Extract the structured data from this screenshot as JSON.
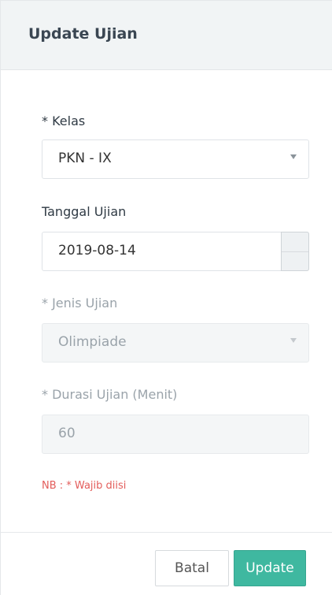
{
  "header": {
    "title": "Update Ujian"
  },
  "form": {
    "kelas": {
      "label": "* Kelas",
      "value": "PKN - IX"
    },
    "tanggal": {
      "label": "Tanggal Ujian",
      "value": "2019-08-14"
    },
    "jenis": {
      "label": "* Jenis Ujian",
      "value": "Olimpiade"
    },
    "durasi": {
      "label": "* Durasi Ujian (Menit)",
      "value": "60"
    },
    "note": "NB : * Wajib diisi"
  },
  "footer": {
    "cancel_label": "Batal",
    "update_label": "Update"
  },
  "colors": {
    "accent": "#3fb8a0",
    "note": "#e35d5b",
    "header_bg": "#f1f4f5"
  }
}
